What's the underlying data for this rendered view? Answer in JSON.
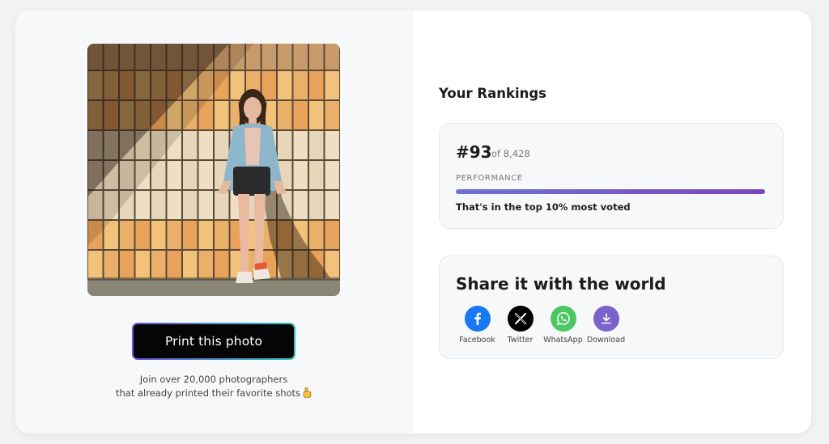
{
  "print_button": {
    "label": "Print this photo"
  },
  "promo": {
    "line1": "Join over 20,000 photographers",
    "line2": "that already printed their favorite shots"
  },
  "rankings": {
    "title": "Your Rankings",
    "rank": "#93",
    "of_total": "of 8,428",
    "performance_label": "PERFORMANCE",
    "performance_fraction": 1.0,
    "summary": "That's in the top 10% most voted"
  },
  "share": {
    "title": "Share it with the world",
    "items": [
      {
        "label": "Facebook",
        "icon": "facebook-icon",
        "color": "#1877f2"
      },
      {
        "label": "Twitter",
        "icon": "x-icon",
        "color": "#000000"
      },
      {
        "label": "WhatsApp",
        "icon": "whatsapp-icon",
        "color": "#4cc764"
      },
      {
        "label": "Download",
        "icon": "download-icon",
        "color": "#7b62cc"
      }
    ]
  }
}
